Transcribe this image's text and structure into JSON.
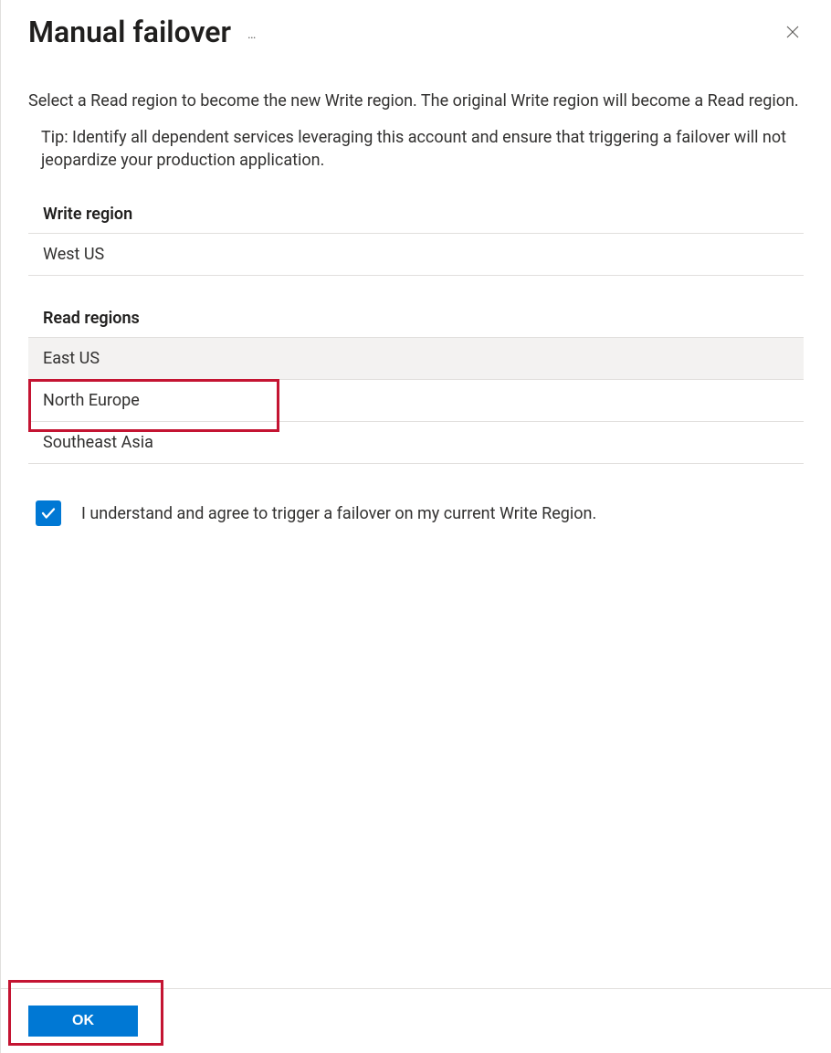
{
  "header": {
    "title": "Manual failover",
    "more_label": "…",
    "close_label": "Close"
  },
  "main": {
    "description": "Select a Read region to become the new Write region. The original Write region will become a Read region.",
    "tip": "Tip: Identify all dependent services leveraging this account and ensure that triggering a failover will not jeopardize your production application.",
    "write_region_header": "Write region",
    "write_region_value": "West US",
    "read_regions_header": "Read regions",
    "read_regions": [
      {
        "label": "East US",
        "selected": true
      },
      {
        "label": "North Europe",
        "selected": false
      },
      {
        "label": "Southeast Asia",
        "selected": false
      }
    ],
    "consent_label": "I understand and agree to trigger a failover on my current Write Region.",
    "consent_checked": true
  },
  "footer": {
    "ok_label": "OK"
  },
  "colors": {
    "primary": "#0078d4",
    "highlight": "#c41432"
  }
}
